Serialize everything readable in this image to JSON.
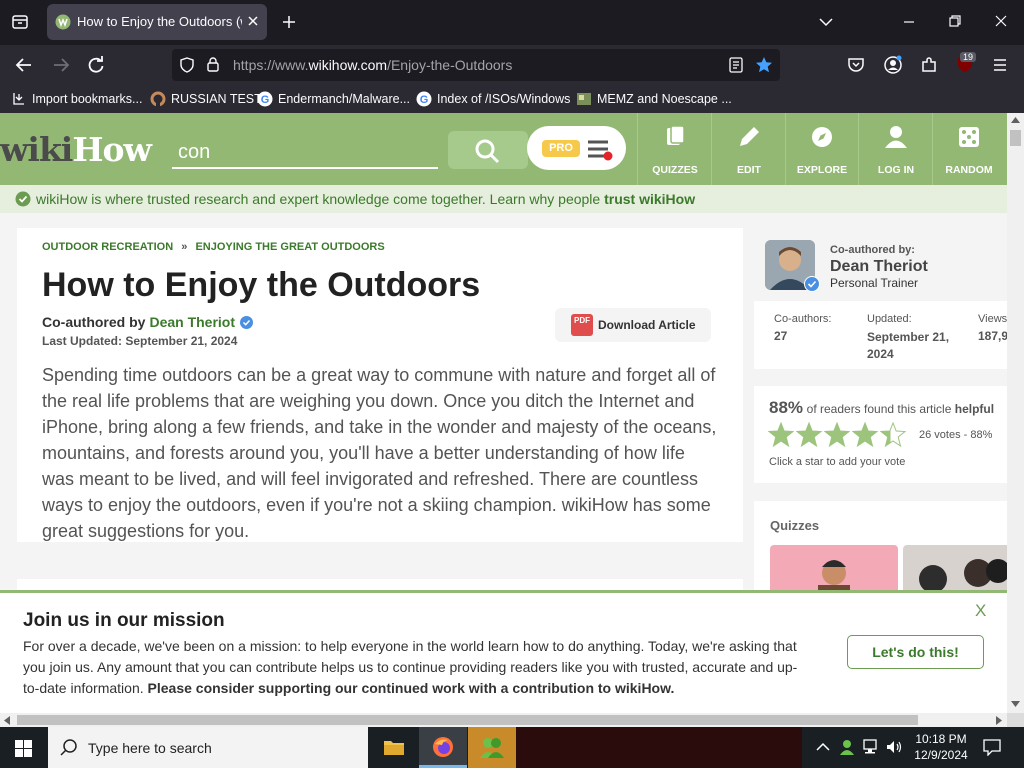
{
  "browser": {
    "tab_title": "How to Enjoy the Outdoors (with",
    "url_prefix": "https://www.",
    "url_domain": "wikihow.com",
    "url_path": "/Enjoy-the-Outdoors",
    "extension_badge": "19",
    "bookmarks": [
      "Import bookmarks...",
      "RUSSIAN TEST",
      "Endermanch/Malware...",
      "Index of /ISOs/Windows",
      "MEMZ and Noescape ..."
    ]
  },
  "site": {
    "logo_wiki": "wiki",
    "logo_how": "How",
    "search_value": "con",
    "pro_label": "PRO",
    "nav": [
      "QUIZZES",
      "EDIT",
      "EXPLORE",
      "LOG IN",
      "RANDOM"
    ],
    "trust_text": "wikiHow is where trusted research and expert knowledge come together. Learn why people ",
    "trust_link": "trust wikiHow"
  },
  "article": {
    "breadcrumb_1": "OUTDOOR RECREATION",
    "breadcrumb_sep": "»",
    "breadcrumb_2": "ENJOYING THE GREAT OUTDOORS",
    "title": "How to Enjoy the Outdoors",
    "coauthored_prefix": "Co-authored by ",
    "author": "Dean Theriot",
    "last_updated": "Last Updated: September 21, 2024",
    "download_label": "Download Article",
    "pdf_label": "PDF",
    "intro_lines": [
      "Spending time outdoors can be a great way to commune with nature and forget all of",
      "the real life problems that are weighing you down. Once you ditch the Internet and",
      "iPhone, bring along a few friends, and take in the wonder and majesty of the oceans,",
      "mountains, and forests around you, you'll have a better understanding of how life",
      "was meant to be lived, and will feel invigorated and refreshed. There are countless",
      "ways to enjoy the outdoors, even if you're not a skiing champion. wikiHow has some",
      "great suggestions for you."
    ]
  },
  "sidebar": {
    "coauthored_label": "Co-authored by:",
    "author_name": "Dean Theriot",
    "author_role": "Personal Trainer",
    "stats": [
      {
        "label": "Co-authors:",
        "value": "27"
      },
      {
        "label": "Updated:",
        "value": "September 21, 2024"
      },
      {
        "label": "Views:",
        "value": "187,9"
      }
    ],
    "rating_percent": "88%",
    "rating_text": "of readers found this article ",
    "rating_bold": "helpful",
    "rating_value": 4.4,
    "votes_text": "26 votes - 88%",
    "click_star": "Click a star to add your vote",
    "quizzes_label": "Quizzes"
  },
  "banner": {
    "heading": "Join us in our mission",
    "close": "X",
    "line1": "For over a decade, we've been on a mission: to help everyone in the world learn how to do anything. Today, we're asking that",
    "line2": "you join us. Any amount that you can contribute helps us to continue providing readers like you with trusted, accurate and up-",
    "line3_prefix": "to-date information. ",
    "line3_bold": "Please consider supporting our continued work with a contribution to wikiHow.",
    "button": "Let's do this!"
  },
  "taskbar": {
    "search_placeholder": "Type here to search",
    "time": "10:18 PM",
    "date": "12/9/2024"
  },
  "colors": {
    "wikihow_green": "#93b874",
    "link_green": "#3b7a2b",
    "dark_chrome": "#1c1b22"
  }
}
